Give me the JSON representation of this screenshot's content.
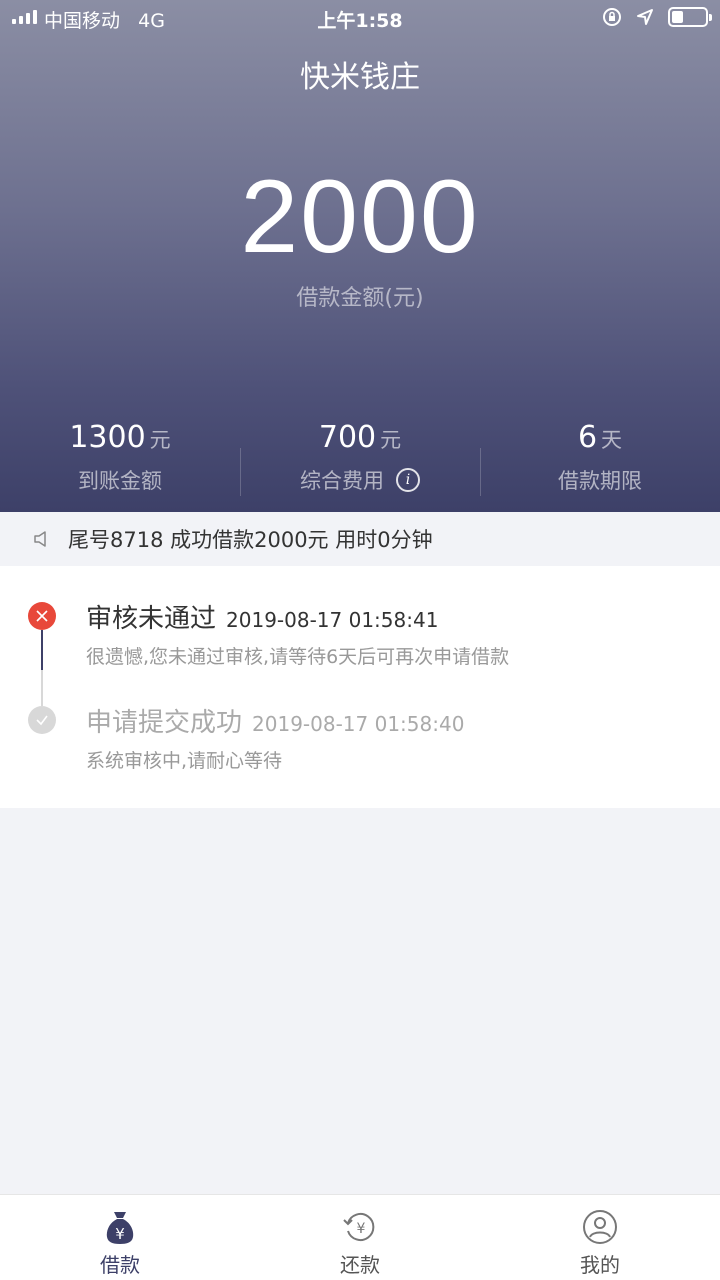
{
  "status_bar": {
    "carrier": "中国移动",
    "network": "4G",
    "time": "上午1:58",
    "battery_level": 0.35
  },
  "app": {
    "title": "快米钱庄"
  },
  "loan": {
    "amount": "2000",
    "amount_label": "借款金额(元)"
  },
  "stats": [
    {
      "value": "1300",
      "unit": "元",
      "label": "到账金额"
    },
    {
      "value": "700",
      "unit": "元",
      "label": "综合费用",
      "info_icon": "info-icon"
    },
    {
      "value": "6",
      "unit": "天",
      "label": "借款期限"
    }
  ],
  "notice": {
    "text": "尾号8718 成功借款2000元 用时0分钟",
    "icon": "speaker-icon"
  },
  "timeline": [
    {
      "title": "审核未通过",
      "time": "2019-08-17 01:58:41",
      "desc": "很遗憾,您未通过审核,请等待6天后可再次申请借款",
      "status": "rejected",
      "color": "#e8483a"
    },
    {
      "title": "申请提交成功",
      "time": "2019-08-17 01:58:40",
      "desc": "系统审核中,请耐心等待",
      "status": "done",
      "color": "#d8d8d8"
    }
  ],
  "tabs": [
    {
      "label": "借款",
      "icon": "money-bag-icon",
      "active": true
    },
    {
      "label": "还款",
      "icon": "repay-icon",
      "active": false
    },
    {
      "label": "我的",
      "icon": "user-icon",
      "active": false
    }
  ],
  "colors": {
    "accent": "#3d4068",
    "reject": "#e8483a",
    "muted": "#999999"
  }
}
